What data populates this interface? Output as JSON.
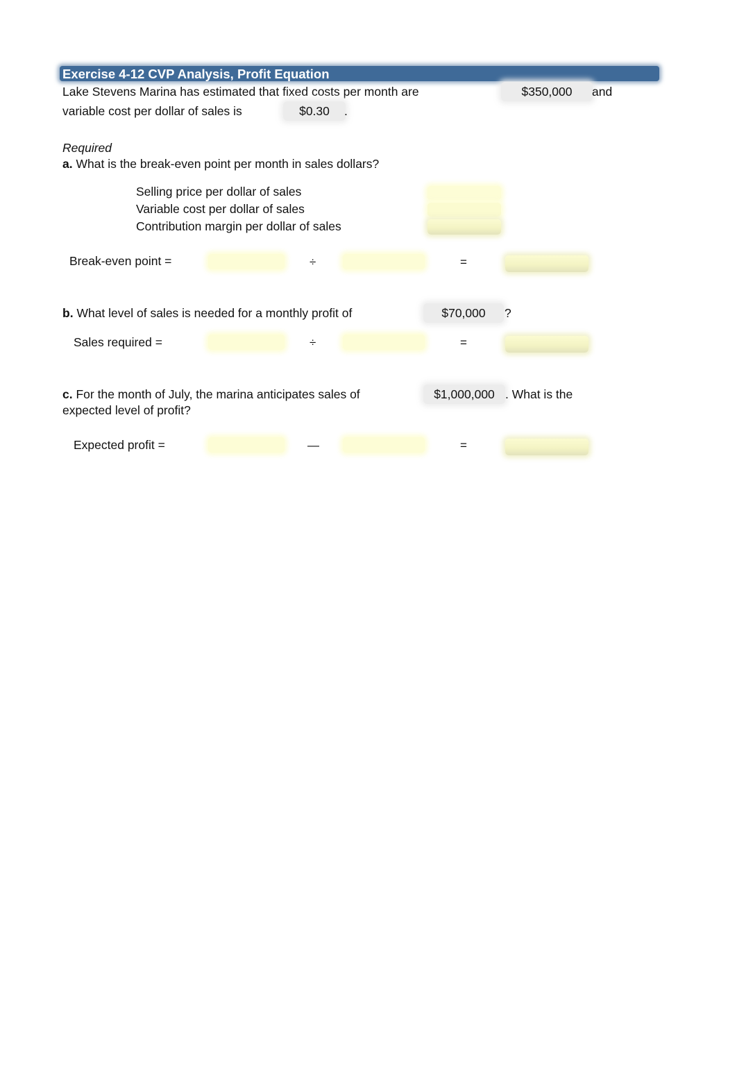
{
  "header": {
    "title": "Exercise 4-12  CVP Analysis, Profit Equation",
    "accent_color": "#3f6a98"
  },
  "intro": {
    "line1_text": "Lake Stevens Marina has estimated that fixed costs per month are",
    "fixed_costs": "$350,000",
    "line1_suffix": "and",
    "line2_text": "variable cost per dollar of sales is",
    "variable_cost": "$0.30",
    "line2_suffix": "."
  },
  "required_label": "Required",
  "part_a": {
    "marker": "a.",
    "question": "What is the break-even point per month in sales dollars?",
    "rows": [
      {
        "label": "Selling price per dollar of sales",
        "value": ""
      },
      {
        "label": "Variable cost per dollar of sales",
        "value": ""
      },
      {
        "label": "Contribution margin per dollar of sales",
        "value": ""
      }
    ],
    "equation": {
      "label": "Break-even point =",
      "operator": "÷",
      "equals": "=",
      "input1": "",
      "input2": "",
      "result": ""
    }
  },
  "part_b": {
    "marker": "b.",
    "question": "What level of sales is needed for a monthly profit of",
    "target_profit": "$70,000",
    "suffix": "?",
    "equation": {
      "label": "Sales required =",
      "operator": "÷",
      "equals": "=",
      "input1": "",
      "input2": "",
      "result": ""
    }
  },
  "part_c": {
    "marker": "c.",
    "question_part1": "For the month of July, the marina anticipates sales of",
    "anticipated_sales": "$1,000,000",
    "question_part2": ". What is the",
    "question_line2": "expected level of profit?",
    "equation": {
      "label": "Expected profit =",
      "operator": "—",
      "equals": "=",
      "input1": "",
      "input2": "",
      "result": ""
    }
  }
}
